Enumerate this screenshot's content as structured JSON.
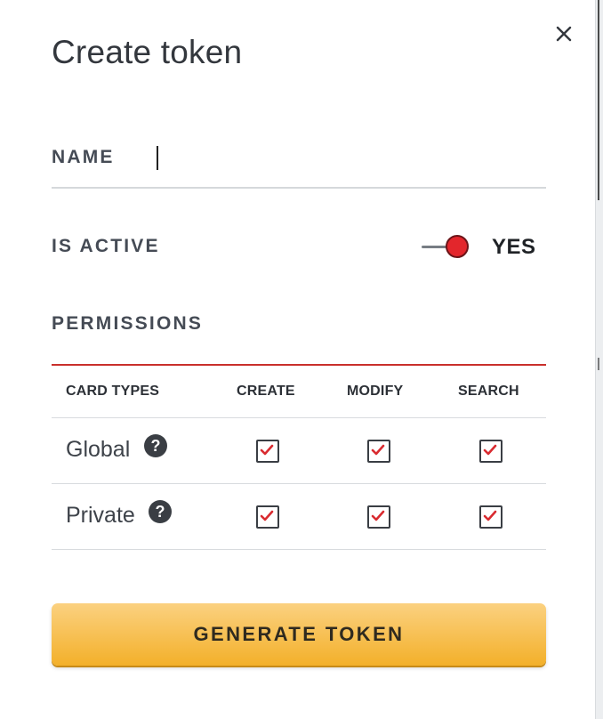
{
  "dialog": {
    "title": "Create token",
    "close_icon": "close-icon",
    "name": {
      "label": "NAME",
      "value": ""
    },
    "is_active": {
      "label": "IS ACTIVE",
      "on": true,
      "state_text": "YES"
    },
    "permissions": {
      "label": "PERMISSIONS",
      "columns": [
        "CARD TYPES",
        "CREATE",
        "MODIFY",
        "SEARCH"
      ],
      "rows": [
        {
          "type": "Global",
          "help_icon": "question-circle-icon",
          "create": true,
          "modify": true,
          "search": true
        },
        {
          "type": "Private",
          "help_icon": "question-circle-icon",
          "create": true,
          "modify": true,
          "search": true
        }
      ]
    },
    "generate_label": "GENERATE TOKEN"
  },
  "colors": {
    "accent_red": "#e3262c",
    "table_rule": "#c9302c",
    "button_top": "#fbd180",
    "button_bottom": "#f3b02a",
    "label_text": "#454b55"
  }
}
